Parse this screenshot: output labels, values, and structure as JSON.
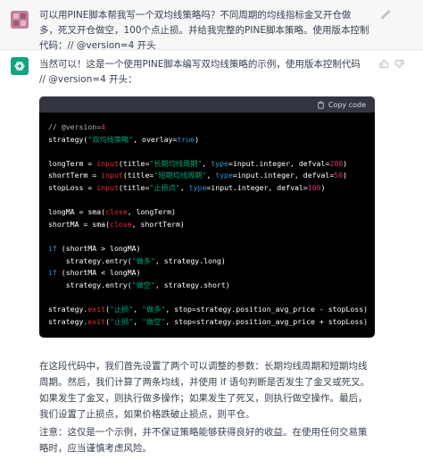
{
  "user_message": {
    "text": "可以用PINE脚本帮我写一个双均线策略吗？不同周期的均线指标金叉开仓做多，死叉开仓做空，100个点止损。并给我完整的PINE脚本策略。使用版本控制代码：// @version=4 开头"
  },
  "assistant_message": {
    "intro": "当然可以！这是一个使用PINE脚本编写双均线策略的示例，使用版本控制代码 // @version=4 开头：",
    "copy_label": "Copy code",
    "code_lines": [
      [
        {
          "t": "// @version=",
          "c": "c-cm"
        },
        {
          "t": "4",
          "c": "c-num"
        }
      ],
      [
        {
          "t": "strategy(",
          "c": "c-plain"
        },
        {
          "t": "\"双均线策略\"",
          "c": "c-str"
        },
        {
          "t": ", overlay=",
          "c": "c-plain"
        },
        {
          "t": "true",
          "c": "c-kw"
        },
        {
          "t": ")",
          "c": "c-plain"
        }
      ],
      [],
      [
        {
          "t": "longTerm = ",
          "c": "c-plain"
        },
        {
          "t": "input",
          "c": "c-fn"
        },
        {
          "t": "(title=",
          "c": "c-plain"
        },
        {
          "t": "\"长期均线周期\"",
          "c": "c-str"
        },
        {
          "t": ", ",
          "c": "c-plain"
        },
        {
          "t": "type",
          "c": "c-kw"
        },
        {
          "t": "=input.integer, defval=",
          "c": "c-plain"
        },
        {
          "t": "200",
          "c": "c-num"
        },
        {
          "t": ")",
          "c": "c-plain"
        }
      ],
      [
        {
          "t": "shortTerm = ",
          "c": "c-plain"
        },
        {
          "t": "input",
          "c": "c-fn"
        },
        {
          "t": "(title=",
          "c": "c-plain"
        },
        {
          "t": "\"短期均线周期\"",
          "c": "c-str"
        },
        {
          "t": ", ",
          "c": "c-plain"
        },
        {
          "t": "type",
          "c": "c-kw"
        },
        {
          "t": "=input.integer, defval=",
          "c": "c-plain"
        },
        {
          "t": "50",
          "c": "c-num"
        },
        {
          "t": ")",
          "c": "c-plain"
        }
      ],
      [
        {
          "t": "stopLoss = ",
          "c": "c-plain"
        },
        {
          "t": "input",
          "c": "c-fn"
        },
        {
          "t": "(title=",
          "c": "c-plain"
        },
        {
          "t": "\"止损点\"",
          "c": "c-str"
        },
        {
          "t": ", ",
          "c": "c-plain"
        },
        {
          "t": "type",
          "c": "c-kw"
        },
        {
          "t": "=input.integer, defval=",
          "c": "c-plain"
        },
        {
          "t": "100",
          "c": "c-num"
        },
        {
          "t": ")",
          "c": "c-plain"
        }
      ],
      [],
      [
        {
          "t": "longMA = sma(",
          "c": "c-plain"
        },
        {
          "t": "close",
          "c": "c-fn"
        },
        {
          "t": ", longTerm)",
          "c": "c-plain"
        }
      ],
      [
        {
          "t": "shortMA = sma(",
          "c": "c-plain"
        },
        {
          "t": "close",
          "c": "c-fn"
        },
        {
          "t": ", shortTerm)",
          "c": "c-plain"
        }
      ],
      [],
      [
        {
          "t": "if",
          "c": "c-kw"
        },
        {
          "t": " (shortMA > longMA)",
          "c": "c-plain"
        }
      ],
      [
        {
          "t": "    strategy.entry(",
          "c": "c-plain"
        },
        {
          "t": "\"做多\"",
          "c": "c-str"
        },
        {
          "t": ", strategy.long)",
          "c": "c-plain"
        }
      ],
      [
        {
          "t": "if",
          "c": "c-kw"
        },
        {
          "t": " (shortMA < longMA)",
          "c": "c-plain"
        }
      ],
      [
        {
          "t": "    strategy.entry(",
          "c": "c-plain"
        },
        {
          "t": "\"做空\"",
          "c": "c-str"
        },
        {
          "t": ", strategy.short)",
          "c": "c-plain"
        }
      ],
      [],
      [
        {
          "t": "strategy.",
          "c": "c-plain"
        },
        {
          "t": "exit",
          "c": "c-fn"
        },
        {
          "t": "(",
          "c": "c-plain"
        },
        {
          "t": "\"止损\"",
          "c": "c-str"
        },
        {
          "t": ", ",
          "c": "c-plain"
        },
        {
          "t": "\"做多\"",
          "c": "c-str"
        },
        {
          "t": ", stop=strategy.position_avg_price - stopLoss)",
          "c": "c-plain"
        }
      ],
      [
        {
          "t": "strategy.",
          "c": "c-plain"
        },
        {
          "t": "exit",
          "c": "c-fn"
        },
        {
          "t": "(",
          "c": "c-plain"
        },
        {
          "t": "\"止损\"",
          "c": "c-str"
        },
        {
          "t": ", ",
          "c": "c-plain"
        },
        {
          "t": "\"做空\"",
          "c": "c-str"
        },
        {
          "t": ", stop=strategy.position_avg_price + stopLoss)",
          "c": "c-plain"
        }
      ]
    ],
    "explanation": "在这段代码中，我们首先设置了两个可以调整的参数：长期均线周期和短期均线周期。然后，我们计算了两条均线，并使用 if 语句判断是否发生了金叉或死叉。如果发生了金叉，则执行做多操作；如果发生了死叉，则执行做空操作。最后，我们设置了止损点，如果价格跌破止损点，则平仓。",
    "note": "注意：这仅是一个示例，并不保证策略能够获得良好的收益。在使用任何交易策略时，应当谨慎考虑风险。"
  },
  "icons": {
    "user_avatar": "user-avatar-icon",
    "assistant_avatar": "openai-logo-icon",
    "edit": "edit-icon",
    "copy": "clipboard-icon",
    "like": "thumbs-up-icon",
    "dislike": "thumbs-down-icon"
  },
  "colors": {
    "user_bg": "#f7f7f8",
    "assistant_avatar": "#10a37f",
    "code_bg": "#000000",
    "code_header": "#343541"
  }
}
